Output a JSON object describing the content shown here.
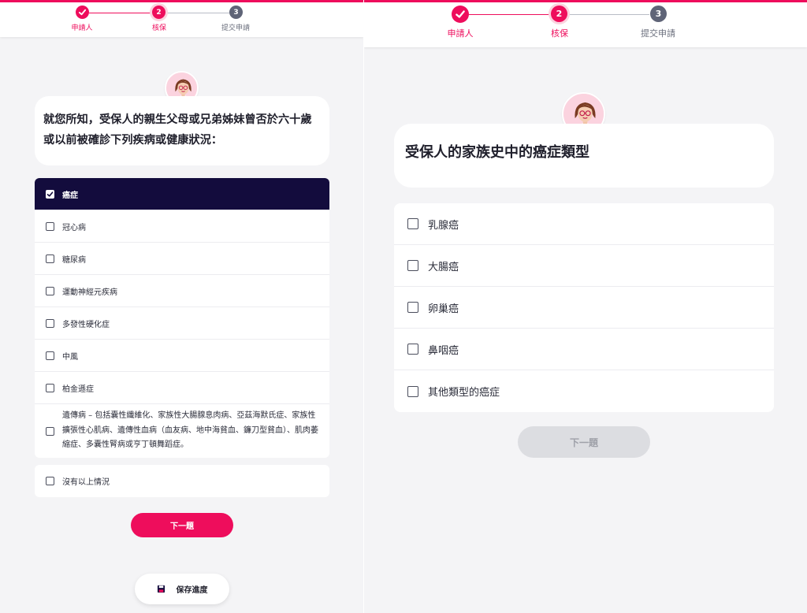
{
  "left": {
    "steps": [
      {
        "label": "申請人",
        "number": "",
        "state": "done"
      },
      {
        "label": "核保",
        "number": "2",
        "state": "current"
      },
      {
        "label": "提交申請",
        "number": "3",
        "state": "todo"
      }
    ],
    "question": "就您所知，受保人的親生父母或兄弟姊妹曾否於六十歲或以前被確診下列疾病或健康狀況：",
    "options": [
      {
        "label": "癌症",
        "checked": true
      },
      {
        "label": "冠心病",
        "checked": false
      },
      {
        "label": "糖尿病",
        "checked": false
      },
      {
        "label": "運動神經元疾病",
        "checked": false
      },
      {
        "label": "多發性硬化症",
        "checked": false
      },
      {
        "label": "中風",
        "checked": false
      },
      {
        "label": "柏金遜症",
        "checked": false
      },
      {
        "label": "遺傳病 – 包括囊性纖維化、家族性大腸腺息肉病、亞茲海默氏症、家族性擴張性心肌病、遺傳性血病（血友病、地中海貧血、鐮刀型貧血）、肌肉萎縮症、多囊性腎病或亨丁頓舞蹈症。",
        "checked": false
      }
    ],
    "none_option": {
      "label": "沒有以上情況",
      "checked": false
    },
    "next_button": "下一題",
    "save_button": "保存進度"
  },
  "right": {
    "steps": [
      {
        "label": "申請人",
        "number": "",
        "state": "done"
      },
      {
        "label": "核保",
        "number": "2",
        "state": "current"
      },
      {
        "label": "提交申請",
        "number": "3",
        "state": "todo"
      }
    ],
    "question": "受保人的家族史中的癌症類型",
    "options": [
      {
        "label": "乳腺癌",
        "checked": false
      },
      {
        "label": "大腸癌",
        "checked": false
      },
      {
        "label": "卵巢癌",
        "checked": false
      },
      {
        "label": "鼻咽癌",
        "checked": false
      },
      {
        "label": "其他類型的癌症",
        "checked": false
      }
    ],
    "next_button": "下一題"
  },
  "colors": {
    "brand": "#ee0d5c",
    "selected_row": "#130c3d",
    "step_todo": "#5f6477",
    "background": "#f4f4f6"
  },
  "icons": {
    "step_done": "check-icon",
    "save": "floppy-disk-icon",
    "avatar": "agent-avatar-icon",
    "checkbox_checked": "checkmark-icon"
  }
}
